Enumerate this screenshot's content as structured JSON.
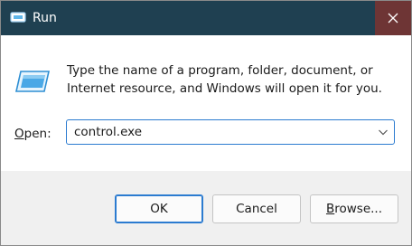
{
  "window": {
    "title": "Run",
    "title_icon": "run-icon",
    "close_icon": "close-icon"
  },
  "content": {
    "icon": "run-program-icon",
    "description": "Type the name of a program, folder, document, or Internet resource, and Windows will open it for you.",
    "open_label": "Open:",
    "open_accesskey": "O",
    "open_label_rest": "pen:",
    "combo_value": "control.exe",
    "combo_arrow_icon": "chevron-down-icon"
  },
  "buttons": {
    "ok": "OK",
    "cancel": "Cancel",
    "browse": "Browse...",
    "browse_accesskey": "B",
    "browse_rest": "rowse..."
  },
  "colors": {
    "titlebar": "#1f4051",
    "close_hover": "#6e3535",
    "accent": "#2b7bd0",
    "footer": "#f0f0f0"
  }
}
